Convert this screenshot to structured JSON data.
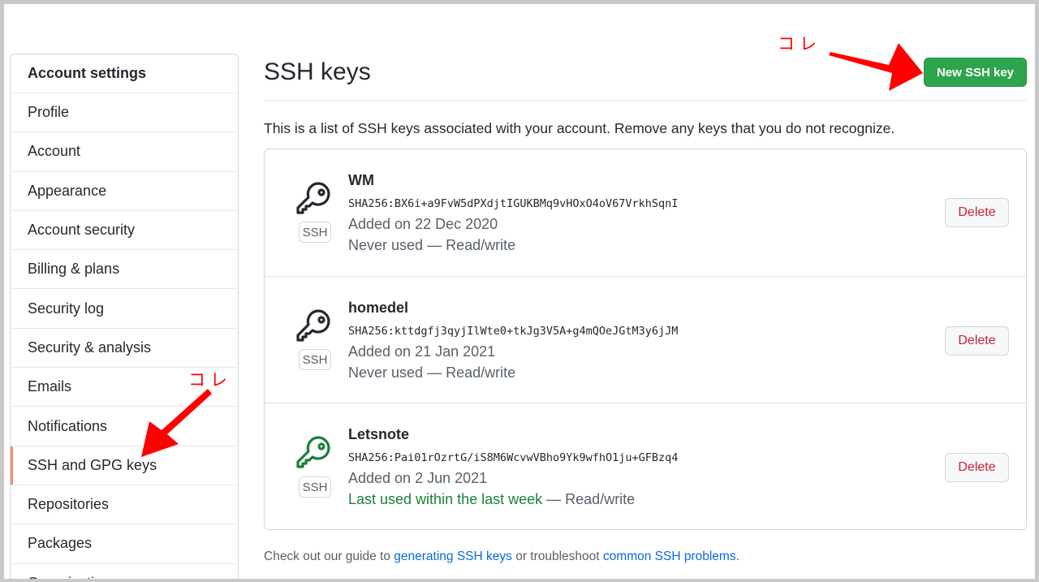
{
  "sidebar": {
    "header": "Account settings",
    "items": [
      {
        "label": "Profile"
      },
      {
        "label": "Account"
      },
      {
        "label": "Appearance"
      },
      {
        "label": "Account security"
      },
      {
        "label": "Billing & plans"
      },
      {
        "label": "Security log"
      },
      {
        "label": "Security & analysis"
      },
      {
        "label": "Emails"
      },
      {
        "label": "Notifications"
      },
      {
        "label": "SSH and GPG keys",
        "selected": true
      },
      {
        "label": "Repositories"
      },
      {
        "label": "Packages"
      },
      {
        "label": "Organizations"
      }
    ]
  },
  "main": {
    "title": "SSH keys",
    "new_button": "New SSH key",
    "intro": "This is a list of SSH keys associated with your account. Remove any keys that you do not recognize.",
    "keys": [
      {
        "name": "WM",
        "fingerprint": "SHA256:BX6i+a9FvW5dPXdjtIGUKBMq9vHOxO4oV67VrkhSqnI",
        "added": "Added on 22 Dec 2020",
        "used": "Never used",
        "access": "Read/write",
        "badge": "SSH",
        "delete_label": "Delete",
        "icon": "key-icon",
        "icon_color": "#24292f"
      },
      {
        "name": "homedel",
        "fingerprint": "SHA256:kttdgfj3qyjIlWte0+tkJg3V5A+g4mQOeJGtM3y6jJM",
        "added": "Added on 21 Jan 2021",
        "used": "Never used",
        "access": "Read/write",
        "badge": "SSH",
        "delete_label": "Delete",
        "icon": "key-icon",
        "icon_color": "#24292f"
      },
      {
        "name": "Letsnote",
        "fingerprint": "SHA256:Pai01rOzrtG/iS8M6WcvwVBho9Yk9wfhO1ju+GFBzq4",
        "added": "Added on 2 Jun 2021",
        "used": "Last used within the last week",
        "access": "Read/write",
        "badge": "SSH",
        "delete_label": "Delete",
        "icon": "key-icon",
        "icon_color": "#1a7f37"
      }
    ],
    "separator": " — ",
    "footer": {
      "prefix": "Check out our guide to ",
      "link1": "generating SSH keys",
      "middle": " or troubleshoot ",
      "link2": "common SSH problems",
      "suffix": "."
    }
  },
  "annotations": {
    "top_label": "コレ",
    "side_label": "コレ",
    "color": "#ff0000"
  },
  "colors": {
    "primary_button": "#2da44e",
    "danger": "#cf222e",
    "link": "#0969da",
    "selected_marker": "#fd8c73",
    "recent_used": "#1a7f37"
  }
}
